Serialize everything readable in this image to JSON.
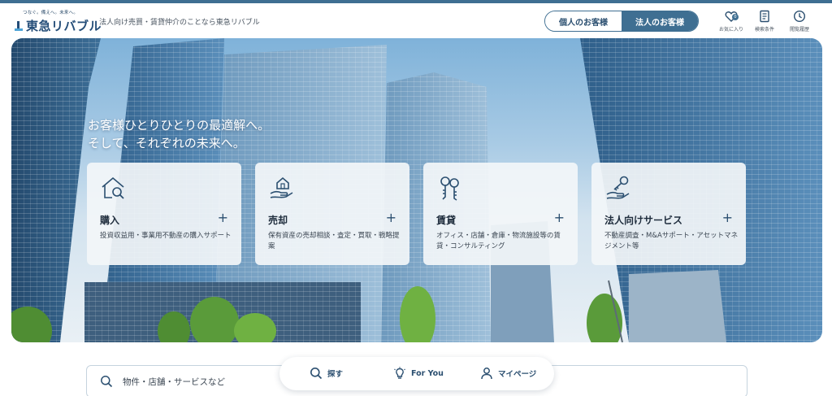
{
  "header": {
    "logo_tagline": "つなぐ。備えへ。未来へ。",
    "logo_name": "東急リバブル",
    "description": "法人向け売買・賃貸仲介のことなら東急リバブル",
    "segment": {
      "individual_label": "個人のお客様",
      "corporate_label": "法人のお客様",
      "selected": "corporate"
    },
    "icons": [
      {
        "name": "favorites",
        "label": "お気に入り",
        "badge": "0"
      },
      {
        "name": "search-conditions",
        "label": "検索条件"
      },
      {
        "name": "history",
        "label": "閲覧履歴"
      }
    ]
  },
  "hero": {
    "headline_line1": "お客様ひとりひとりの最適解へ。",
    "headline_line2": "そして、それぞれの未来へ。",
    "cards": [
      {
        "title": "購入",
        "description": "投資収益用・事業用不動産の購入サポート",
        "icon": "house-search-icon"
      },
      {
        "title": "売却",
        "description": "保有資産の売却相談・査定・買取・戦略提案",
        "icon": "house-hand-icon"
      },
      {
        "title": "賃貸",
        "description": "オフィス・店舗・倉庫・物流施設等の賃貸・コンサルティング",
        "icon": "keys-icon"
      },
      {
        "title": "法人向けサービス",
        "description": "不動産調査・M&Aサポート・アセットマネジメント等",
        "icon": "key-hand-icon"
      }
    ]
  },
  "search": {
    "placeholder": "物件・店舗・サービスなど"
  },
  "bottom_nav": [
    {
      "label": "探す",
      "icon": "search-icon"
    },
    {
      "label": "For You",
      "icon": "lightbulb-icon"
    },
    {
      "label": "マイページ",
      "icon": "person-icon"
    }
  ],
  "colors": {
    "brand": "#3f6f92",
    "brand_dark": "#244d78",
    "text": "#1f2d3d"
  }
}
